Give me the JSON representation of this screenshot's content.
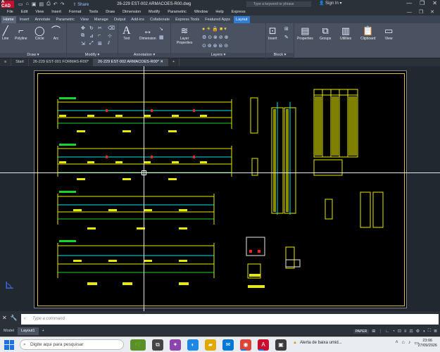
{
  "titlebar": {
    "app_logo": "A CAD",
    "share": "Share",
    "document_title": "26-229 EST-002 ARMACOES-R00.dwg",
    "search_placeholder": "Type a keyword or phrase",
    "sign_in": "Sign In"
  },
  "menubar": [
    "File",
    "Edit",
    "View",
    "Insert",
    "Format",
    "Tools",
    "Draw",
    "Dimension",
    "Modify",
    "Parametric",
    "Window",
    "Help",
    "Express"
  ],
  "ribbon_tabs": [
    "Home",
    "Insert",
    "Annotate",
    "Parametric",
    "View",
    "Manage",
    "Output",
    "Add-ins",
    "Collaborate",
    "Express Tools",
    "Featured Apps",
    "Layout"
  ],
  "ribbon": {
    "draw_group": "Draw",
    "modify_group": "Modify",
    "annotation_group": "Annotation",
    "layers_group": "Layers",
    "block_group": "Block",
    "tools": {
      "line": "Line",
      "polyline": "Polyline",
      "circle": "Circle",
      "arc": "Arc",
      "text": "Text",
      "dimension": "Dimension",
      "layer_properties": "Layer Properties",
      "insert": "Insert",
      "properties": "Properties",
      "groups": "Groups",
      "utilities": "Utilities",
      "clipboard": "Clipboard",
      "view": "View"
    }
  },
  "file_tabs": [
    "Start",
    "26-229 EST-001 FORMAS-R00*",
    "26-229 EST-002 ARMACOES-R00*"
  ],
  "command": {
    "placeholder": "Type a command"
  },
  "layout_tabs": [
    "Model",
    "Layout1"
  ],
  "status": {
    "paper": "PAPER"
  },
  "taskbar": {
    "search": "Digite aqui para pesquisar",
    "notification": "Alerta de baixa umid...",
    "time": "23:06",
    "date": "27/09/2026"
  },
  "colors": {
    "drawing_yellow": "#e8e800",
    "drawing_cyan": "#00e5e5",
    "drawing_green": "#16d62a",
    "drawing_red": "#ff2020",
    "layout_tab_accent": "#2e7dd7"
  }
}
